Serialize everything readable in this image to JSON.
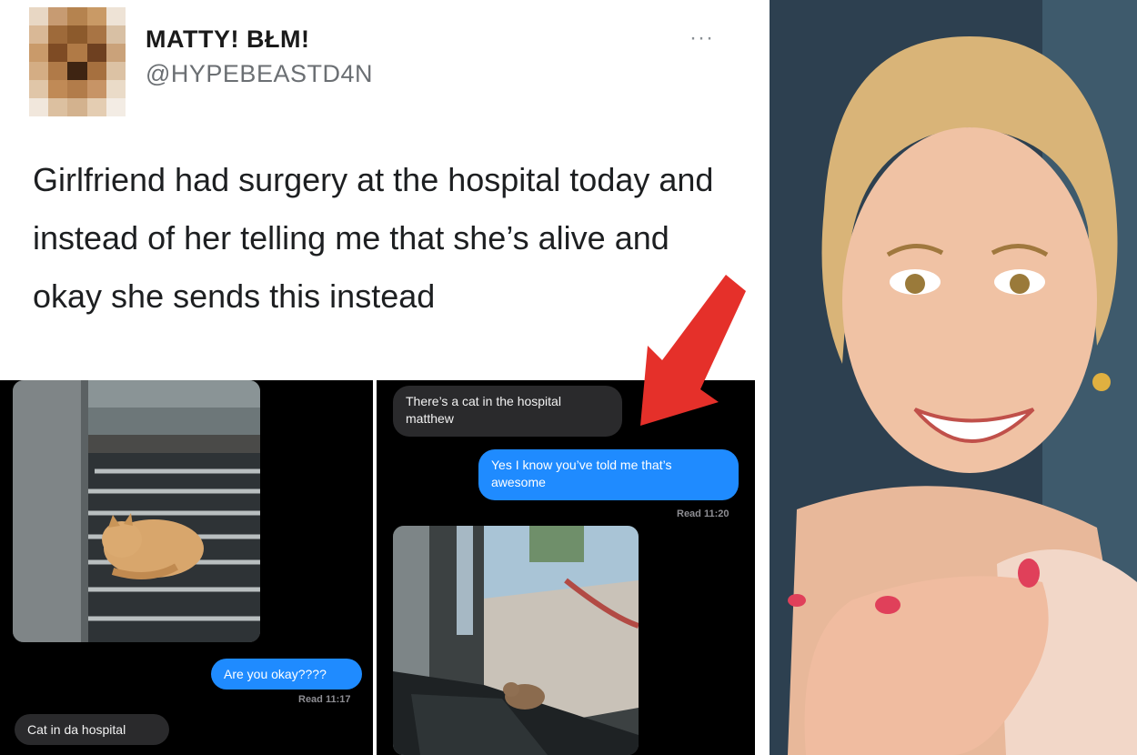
{
  "tweet": {
    "display_name": "MATTY! BŁM!",
    "handle": "@HYPEBEASTD4N",
    "more_icon": "···",
    "text": "Girlfriend had surgery at the hospital today and instead of her telling me that she’s alive and okay she sends this instead"
  },
  "left_screenshot": {
    "sent_message": "Are you okay????",
    "read_receipt": "Read 11:17",
    "received_message": "Cat in da hospital"
  },
  "right_screenshot": {
    "received_message": "There’s a cat in the hospital matthew",
    "sent_message": "Yes I know you’ve told me that’s awesome",
    "read_receipt": "Read 11:20"
  },
  "colors": {
    "imessage_blue": "#1f8bff",
    "received_gray": "#2a2a2c",
    "arrow_red": "#e5302a"
  },
  "icons": [
    "more-icon",
    "red-arrow-icon"
  ]
}
